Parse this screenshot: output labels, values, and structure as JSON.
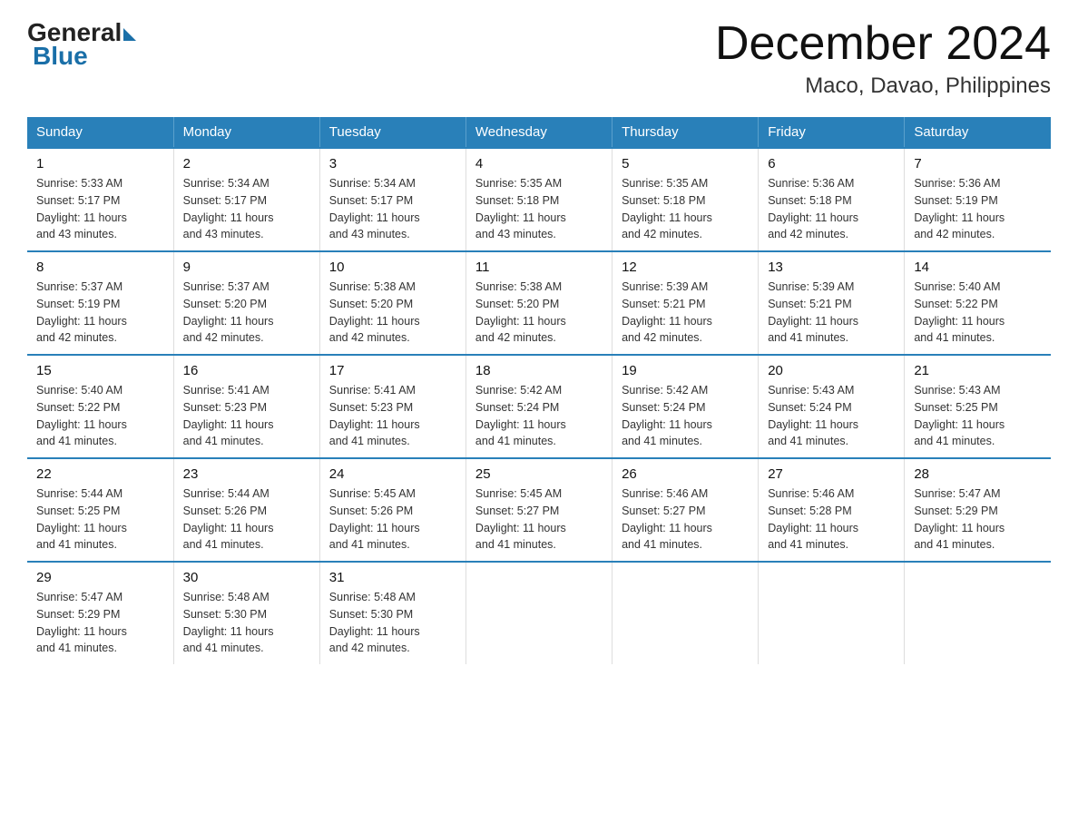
{
  "logo": {
    "general": "General",
    "blue": "Blue"
  },
  "title": "December 2024",
  "subtitle": "Maco, Davao, Philippines",
  "days_header": [
    "Sunday",
    "Monday",
    "Tuesday",
    "Wednesday",
    "Thursday",
    "Friday",
    "Saturday"
  ],
  "weeks": [
    [
      {
        "day": "1",
        "sunrise": "5:33 AM",
        "sunset": "5:17 PM",
        "daylight": "11 hours and 43 minutes."
      },
      {
        "day": "2",
        "sunrise": "5:34 AM",
        "sunset": "5:17 PM",
        "daylight": "11 hours and 43 minutes."
      },
      {
        "day": "3",
        "sunrise": "5:34 AM",
        "sunset": "5:17 PM",
        "daylight": "11 hours and 43 minutes."
      },
      {
        "day": "4",
        "sunrise": "5:35 AM",
        "sunset": "5:18 PM",
        "daylight": "11 hours and 43 minutes."
      },
      {
        "day": "5",
        "sunrise": "5:35 AM",
        "sunset": "5:18 PM",
        "daylight": "11 hours and 42 minutes."
      },
      {
        "day": "6",
        "sunrise": "5:36 AM",
        "sunset": "5:18 PM",
        "daylight": "11 hours and 42 minutes."
      },
      {
        "day": "7",
        "sunrise": "5:36 AM",
        "sunset": "5:19 PM",
        "daylight": "11 hours and 42 minutes."
      }
    ],
    [
      {
        "day": "8",
        "sunrise": "5:37 AM",
        "sunset": "5:19 PM",
        "daylight": "11 hours and 42 minutes."
      },
      {
        "day": "9",
        "sunrise": "5:37 AM",
        "sunset": "5:20 PM",
        "daylight": "11 hours and 42 minutes."
      },
      {
        "day": "10",
        "sunrise": "5:38 AM",
        "sunset": "5:20 PM",
        "daylight": "11 hours and 42 minutes."
      },
      {
        "day": "11",
        "sunrise": "5:38 AM",
        "sunset": "5:20 PM",
        "daylight": "11 hours and 42 minutes."
      },
      {
        "day": "12",
        "sunrise": "5:39 AM",
        "sunset": "5:21 PM",
        "daylight": "11 hours and 42 minutes."
      },
      {
        "day": "13",
        "sunrise": "5:39 AM",
        "sunset": "5:21 PM",
        "daylight": "11 hours and 41 minutes."
      },
      {
        "day": "14",
        "sunrise": "5:40 AM",
        "sunset": "5:22 PM",
        "daylight": "11 hours and 41 minutes."
      }
    ],
    [
      {
        "day": "15",
        "sunrise": "5:40 AM",
        "sunset": "5:22 PM",
        "daylight": "11 hours and 41 minutes."
      },
      {
        "day": "16",
        "sunrise": "5:41 AM",
        "sunset": "5:23 PM",
        "daylight": "11 hours and 41 minutes."
      },
      {
        "day": "17",
        "sunrise": "5:41 AM",
        "sunset": "5:23 PM",
        "daylight": "11 hours and 41 minutes."
      },
      {
        "day": "18",
        "sunrise": "5:42 AM",
        "sunset": "5:24 PM",
        "daylight": "11 hours and 41 minutes."
      },
      {
        "day": "19",
        "sunrise": "5:42 AM",
        "sunset": "5:24 PM",
        "daylight": "11 hours and 41 minutes."
      },
      {
        "day": "20",
        "sunrise": "5:43 AM",
        "sunset": "5:24 PM",
        "daylight": "11 hours and 41 minutes."
      },
      {
        "day": "21",
        "sunrise": "5:43 AM",
        "sunset": "5:25 PM",
        "daylight": "11 hours and 41 minutes."
      }
    ],
    [
      {
        "day": "22",
        "sunrise": "5:44 AM",
        "sunset": "5:25 PM",
        "daylight": "11 hours and 41 minutes."
      },
      {
        "day": "23",
        "sunrise": "5:44 AM",
        "sunset": "5:26 PM",
        "daylight": "11 hours and 41 minutes."
      },
      {
        "day": "24",
        "sunrise": "5:45 AM",
        "sunset": "5:26 PM",
        "daylight": "11 hours and 41 minutes."
      },
      {
        "day": "25",
        "sunrise": "5:45 AM",
        "sunset": "5:27 PM",
        "daylight": "11 hours and 41 minutes."
      },
      {
        "day": "26",
        "sunrise": "5:46 AM",
        "sunset": "5:27 PM",
        "daylight": "11 hours and 41 minutes."
      },
      {
        "day": "27",
        "sunrise": "5:46 AM",
        "sunset": "5:28 PM",
        "daylight": "11 hours and 41 minutes."
      },
      {
        "day": "28",
        "sunrise": "5:47 AM",
        "sunset": "5:29 PM",
        "daylight": "11 hours and 41 minutes."
      }
    ],
    [
      {
        "day": "29",
        "sunrise": "5:47 AM",
        "sunset": "5:29 PM",
        "daylight": "11 hours and 41 minutes."
      },
      {
        "day": "30",
        "sunrise": "5:48 AM",
        "sunset": "5:30 PM",
        "daylight": "11 hours and 41 minutes."
      },
      {
        "day": "31",
        "sunrise": "5:48 AM",
        "sunset": "5:30 PM",
        "daylight": "11 hours and 42 minutes."
      },
      null,
      null,
      null,
      null
    ]
  ],
  "sunrise_label": "Sunrise:",
  "sunset_label": "Sunset:",
  "daylight_label": "Daylight:"
}
